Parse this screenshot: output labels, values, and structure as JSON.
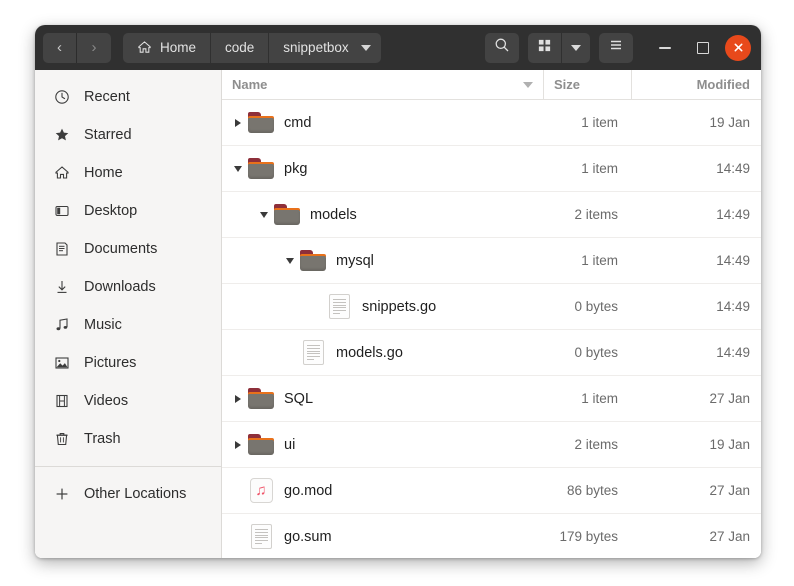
{
  "window": {
    "nav": {
      "back_label": "‹",
      "forward_label": "›"
    },
    "breadcrumbs": [
      {
        "label": "Home",
        "icon": "home-icon"
      },
      {
        "label": "code",
        "icon": ""
      },
      {
        "label": "snippetbox",
        "icon": ""
      }
    ],
    "controls": {
      "search_icon": "search-icon",
      "grid_view_icon": "grid-view-icon",
      "view_dropdown_icon": "chevron-down-icon",
      "menu_icon": "hamburger-menu-icon",
      "minimize_icon": "minimize-icon",
      "maximize_icon": "maximize-icon",
      "close_icon": "close-icon",
      "close_color": "#e8491b"
    }
  },
  "sidebar": {
    "items": [
      {
        "label": "Recent",
        "icon": "clock-icon"
      },
      {
        "label": "Starred",
        "icon": "star-icon"
      },
      {
        "label": "Home",
        "icon": "home-icon"
      },
      {
        "label": "Desktop",
        "icon": "desktop-icon"
      },
      {
        "label": "Documents",
        "icon": "documents-icon"
      },
      {
        "label": "Downloads",
        "icon": "download-icon"
      },
      {
        "label": "Music",
        "icon": "music-icon"
      },
      {
        "label": "Pictures",
        "icon": "pictures-icon"
      },
      {
        "label": "Videos",
        "icon": "videos-icon"
      },
      {
        "label": "Trash",
        "icon": "trash-icon"
      }
    ],
    "other_locations": {
      "label": "Other Locations",
      "icon": "plus-icon"
    }
  },
  "filelist": {
    "columns": {
      "name": "Name",
      "size": "Size",
      "modified": "Modified"
    },
    "sort_indicator": "chevron-down-icon",
    "rows": [
      {
        "name": "cmd",
        "size": "1 item",
        "modified": "19 Jan",
        "type": "folder",
        "indent": 0,
        "expander": "collapsed"
      },
      {
        "name": "pkg",
        "size": "1 item",
        "modified": "14:49",
        "type": "folder",
        "indent": 0,
        "expander": "expanded"
      },
      {
        "name": "models",
        "size": "2 items",
        "modified": "14:49",
        "type": "folder",
        "indent": 1,
        "expander": "expanded"
      },
      {
        "name": "mysql",
        "size": "1 item",
        "modified": "14:49",
        "type": "folder",
        "indent": 2,
        "expander": "expanded"
      },
      {
        "name": "snippets.go",
        "size": "0 bytes",
        "modified": "14:49",
        "type": "text",
        "indent": 3,
        "expander": "none"
      },
      {
        "name": "models.go",
        "size": "0 bytes",
        "modified": "14:49",
        "type": "text",
        "indent": 2,
        "expander": "none"
      },
      {
        "name": "SQL",
        "size": "1 item",
        "modified": "27 Jan",
        "type": "folder",
        "indent": 0,
        "expander": "collapsed"
      },
      {
        "name": "ui",
        "size": "2 items",
        "modified": "19 Jan",
        "type": "folder",
        "indent": 0,
        "expander": "collapsed"
      },
      {
        "name": "go.mod",
        "size": "86 bytes",
        "modified": "27 Jan",
        "type": "music",
        "indent": 0,
        "expander": "none"
      },
      {
        "name": "go.sum",
        "size": "179 bytes",
        "modified": "27 Jan",
        "type": "text",
        "indent": 0,
        "expander": "none"
      }
    ]
  }
}
